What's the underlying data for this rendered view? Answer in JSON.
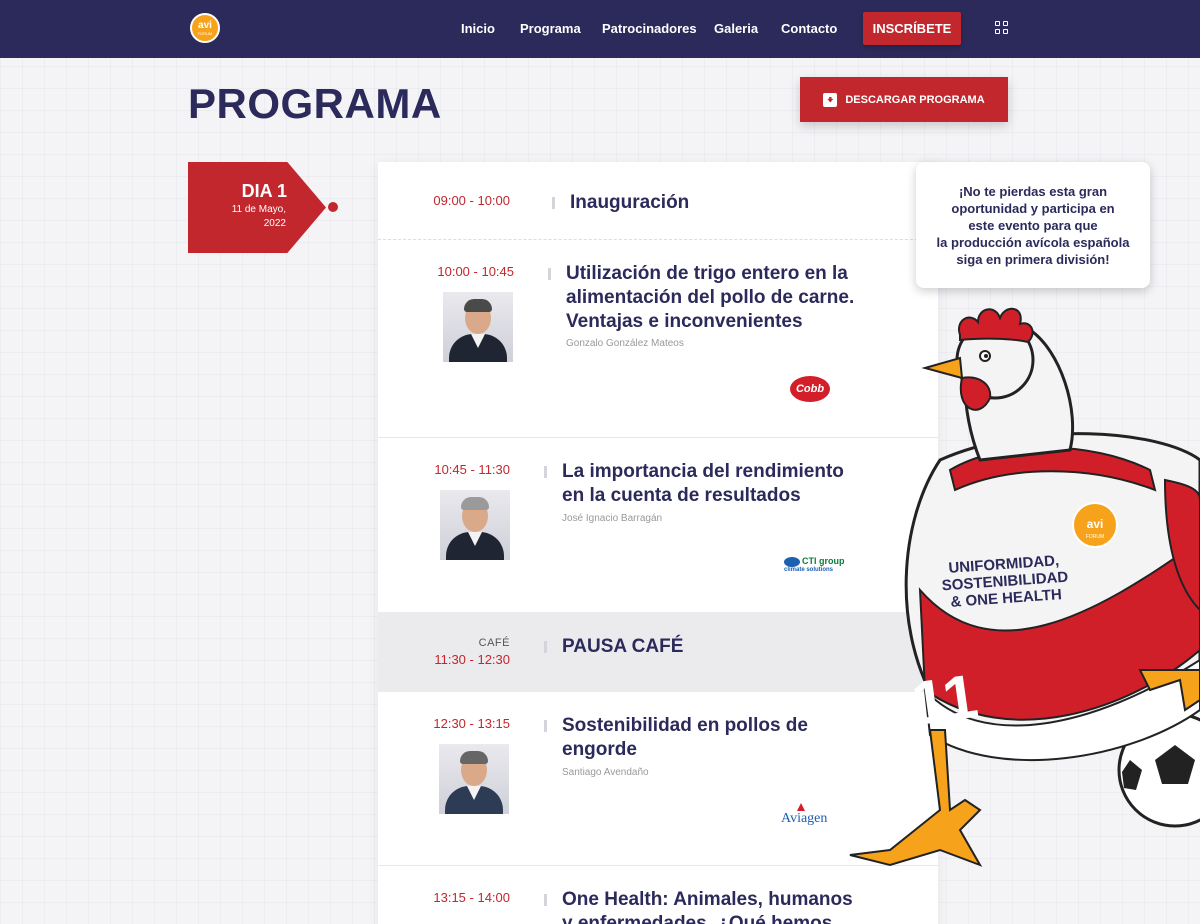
{
  "nav": {
    "logo_text": "avi",
    "logo_subtext": "FORUM",
    "items": [
      "Inicio",
      "Programa",
      "Patrocinadores",
      "Galeria",
      "Contacto"
    ],
    "cta_label": "INSCRÍBETE"
  },
  "header": {
    "title": "PROGRAMA",
    "download_label": "DESCARGAR PROGRAMA"
  },
  "day": {
    "title": "DIA 1",
    "date_line1": "11 de Mayo,",
    "date_line2": "2022"
  },
  "schedule": [
    {
      "time": "09:00 - 10:00",
      "title": "Inauguración"
    },
    {
      "time": "10:00 - 10:45",
      "title_lines": [
        "Utilización de trigo entero en la",
        "alimentación del pollo de carne.",
        "Ventajas e inconvenientes"
      ],
      "speaker": "Gonzalo González Mateos",
      "sponsor": "Cobb"
    },
    {
      "time": "10:45 - 11:30",
      "title_lines": [
        "La importancia del rendimiento",
        "en la cuenta de resultados"
      ],
      "speaker": "José Ignacio Barragán",
      "sponsor": "CTI group",
      "sponsor_sub": "climate solutions"
    },
    {
      "label": "CAFÉ",
      "time": "11:30 - 12:30",
      "title": "PAUSA CAFÉ"
    },
    {
      "time": "12:30 - 13:15",
      "title_lines": [
        "Sostenibilidad en pollos de",
        "engorde"
      ],
      "speaker": "Santiago Avendaño",
      "sponsor": "Aviagen"
    },
    {
      "time": "13:15 - 14:00",
      "title_lines": [
        "One Health: Animales, humanos",
        "y enfermedades. ¿Qué hemos"
      ]
    }
  ],
  "info_box": {
    "lines": [
      "¡No te pierdas esta gran",
      "oportunidad y participa en",
      "este evento para que",
      "la producción avícola española",
      "siga en primera división!"
    ]
  },
  "mascot": {
    "jersey_lines": [
      "UNIFORMIDAD,",
      "SOSTENIBILIDAD",
      "& ONE HEALTH"
    ],
    "number": "11",
    "badge_text": "avi",
    "badge_sub": "FORUM"
  },
  "colors": {
    "navy": "#2b2a5a",
    "red": "#c1272d",
    "orange": "#f7a21b"
  }
}
